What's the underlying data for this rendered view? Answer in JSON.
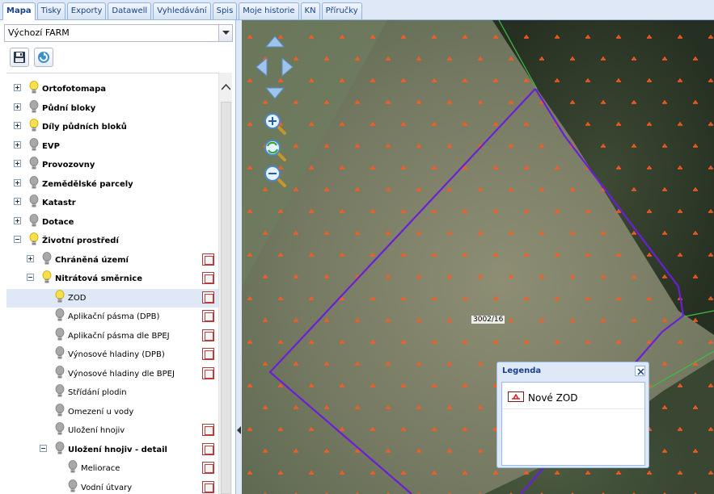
{
  "tabs": [
    "Mapa",
    "Tisky",
    "Exporty",
    "Datawell",
    "Vyhledávání",
    "Spis",
    "Moje historie",
    "KN",
    "Příručky"
  ],
  "active_tab": "Mapa",
  "layer_select": {
    "value": "Výchozí FARM"
  },
  "toolbar": {
    "save_icon": "floppy-disk-icon",
    "refresh_icon": "refresh-icon"
  },
  "tree": [
    {
      "label": "Ortofotomapa",
      "level": 0,
      "expander": "plus",
      "bulb": "on",
      "bold": true,
      "legend": false
    },
    {
      "label": "Půdní bloky",
      "level": 0,
      "expander": "plus",
      "bulb": "off",
      "bold": true,
      "legend": false
    },
    {
      "label": "Díly půdních bloků",
      "level": 0,
      "expander": "plus",
      "bulb": "on",
      "bold": true,
      "legend": false
    },
    {
      "label": "EVP",
      "level": 0,
      "expander": "plus",
      "bulb": "off",
      "bold": true,
      "legend": false
    },
    {
      "label": "Provozovny",
      "level": 0,
      "expander": "plus",
      "bulb": "off",
      "bold": true,
      "legend": false
    },
    {
      "label": "Zemědělské parcely",
      "level": 0,
      "expander": "plus",
      "bulb": "off",
      "bold": true,
      "legend": false
    },
    {
      "label": "Katastr",
      "level": 0,
      "expander": "plus",
      "bulb": "off",
      "bold": true,
      "legend": false
    },
    {
      "label": "Dotace",
      "level": 0,
      "expander": "plus",
      "bulb": "off",
      "bold": true,
      "legend": false
    },
    {
      "label": "Životní prostředí",
      "level": 0,
      "expander": "minus",
      "bulb": "on",
      "bold": true,
      "legend": false
    },
    {
      "label": "Chráněná území",
      "level": 1,
      "expander": "plus",
      "bulb": "off",
      "bold": true,
      "legend": true
    },
    {
      "label": "Nitrátová směrnice",
      "level": 1,
      "expander": "minus",
      "bulb": "on",
      "bold": true,
      "legend": true
    },
    {
      "label": "ZOD",
      "level": 2,
      "expander": "none",
      "bulb": "on",
      "bold": false,
      "legend": true,
      "selected": true
    },
    {
      "label": "Aplikační pásma (DPB)",
      "level": 2,
      "expander": "none",
      "bulb": "off",
      "bold": false,
      "legend": true
    },
    {
      "label": "Aplikační pásma dle BPEJ",
      "level": 2,
      "expander": "none",
      "bulb": "off",
      "bold": false,
      "legend": true
    },
    {
      "label": "Výnosové hladiny (DPB)",
      "level": 2,
      "expander": "none",
      "bulb": "off",
      "bold": false,
      "legend": true
    },
    {
      "label": "Výnosové hladiny dle BPEJ",
      "level": 2,
      "expander": "none",
      "bulb": "off",
      "bold": false,
      "legend": true
    },
    {
      "label": "Střídání plodin",
      "level": 2,
      "expander": "none",
      "bulb": "off",
      "bold": false,
      "legend": false
    },
    {
      "label": "Omezení u vody",
      "level": 2,
      "expander": "none",
      "bulb": "off",
      "bold": false,
      "legend": false
    },
    {
      "label": "Uložení hnojiv",
      "level": 2,
      "expander": "none",
      "bulb": "off",
      "bold": false,
      "legend": true
    },
    {
      "label": "Uložení hnojiv - detail",
      "level": 2,
      "expander": "minus",
      "bulb": "off",
      "bold": true,
      "legend": true
    },
    {
      "label": "Meliorace",
      "level": 3,
      "expander": "none",
      "bulb": "off",
      "bold": false,
      "legend": true
    },
    {
      "label": "Vodní útvary",
      "level": 3,
      "expander": "none",
      "bulb": "off",
      "bold": false,
      "legend": true
    }
  ],
  "map": {
    "parcel_label": "3002/16",
    "parcel_color": "#6a1fd6",
    "marker_color": "#ff5a1f",
    "boundary_color": "#3fbf3f"
  },
  "legend": {
    "title": "Legenda",
    "item": "Nové ZOD",
    "close_icon": "close-icon"
  }
}
